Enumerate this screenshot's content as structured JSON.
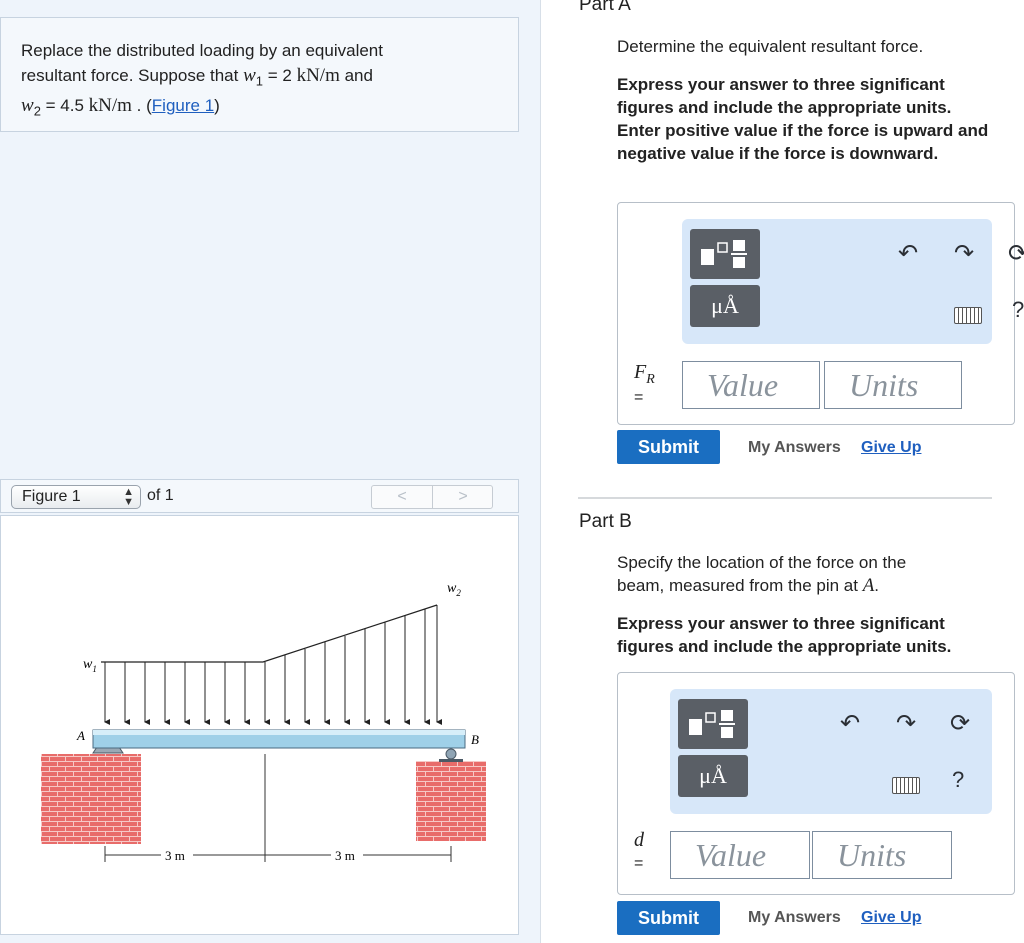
{
  "problem": {
    "line1": "Replace the distributed loading by an equivalent",
    "line2_pre": "resultant force. Suppose that ",
    "w1_sym": "w",
    "w1_sub": "1",
    "w1_eq": " = 2 ",
    "w1_unit": "kN/m",
    "line2_post": " and",
    "w2_sym": "w",
    "w2_sub": "2",
    "w2_eq": " = 4.5 ",
    "w2_unit": "kN/m",
    "line3_post": " . (",
    "figure_link": "Figure 1",
    "close": ")"
  },
  "figure_nav": {
    "selected": "Figure 1",
    "of": "of 1",
    "prev": "<",
    "next": ">"
  },
  "figure": {
    "w1": "w",
    "w1_sub": "1",
    "w2": "w",
    "w2_sub": "2",
    "A": "A",
    "B": "B",
    "dim1": "3 m",
    "dim2": "3 m"
  },
  "partA": {
    "title": "Part A",
    "question": "Determine the equivalent resultant force.",
    "instructions": "Express your answer to three significant figures and include the appropriate units. Enter positive value if the force is upward and negative value if the force is downward.",
    "var": "F",
    "var_sub": "R",
    "eq": "=",
    "value_placeholder": "Value",
    "units_placeholder": "Units",
    "submit": "Submit",
    "my_answers": "My Answers",
    "give_up": "Give Up",
    "mu_label": "μÅ",
    "help": "?"
  },
  "partB": {
    "title": "Part B",
    "question_pre": "Specify the location of the force on the beam, measured from the pin at ",
    "question_var": "A",
    "question_post": ".",
    "instructions": "Express your answer to three significant figures and include the appropriate units.",
    "var": "d",
    "eq": "=",
    "value_placeholder": "Value",
    "units_placeholder": "Units",
    "submit": "Submit",
    "my_answers": "My Answers",
    "give_up": "Give Up",
    "mu_label": "μÅ",
    "help": "?"
  }
}
